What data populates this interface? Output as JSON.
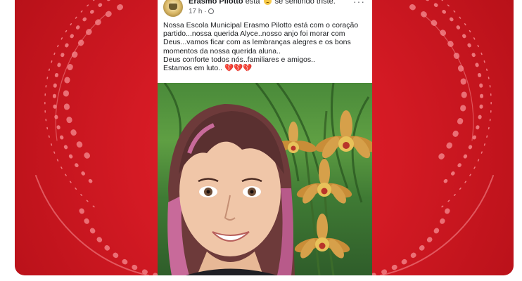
{
  "post": {
    "author": "Erasmo Pilotto",
    "feeling_prefix": "está",
    "feeling_text": "se sentindo triste.",
    "time": "17 h ·",
    "more_label": "···",
    "paragraphs": [
      "Nossa Escola Municipal Erasmo Pilotto está com o coração partido...nossa querida Alyce..nosso anjo foi morar com Deus...vamos ficar com as lembranças alegres  e os bons momentos da nossa querida aluna..",
      "Deus conforte todos nós..familiares e amigos..",
      "Estamos em luto.."
    ],
    "hearts": "💔💔💔"
  },
  "colors": {
    "background_red": "#d41a24",
    "ring_light": "#f07a7f"
  },
  "icons": {
    "avatar": "school-avatar",
    "feeling": "sad-face-icon",
    "privacy": "globe-icon",
    "more": "more-options-icon"
  }
}
